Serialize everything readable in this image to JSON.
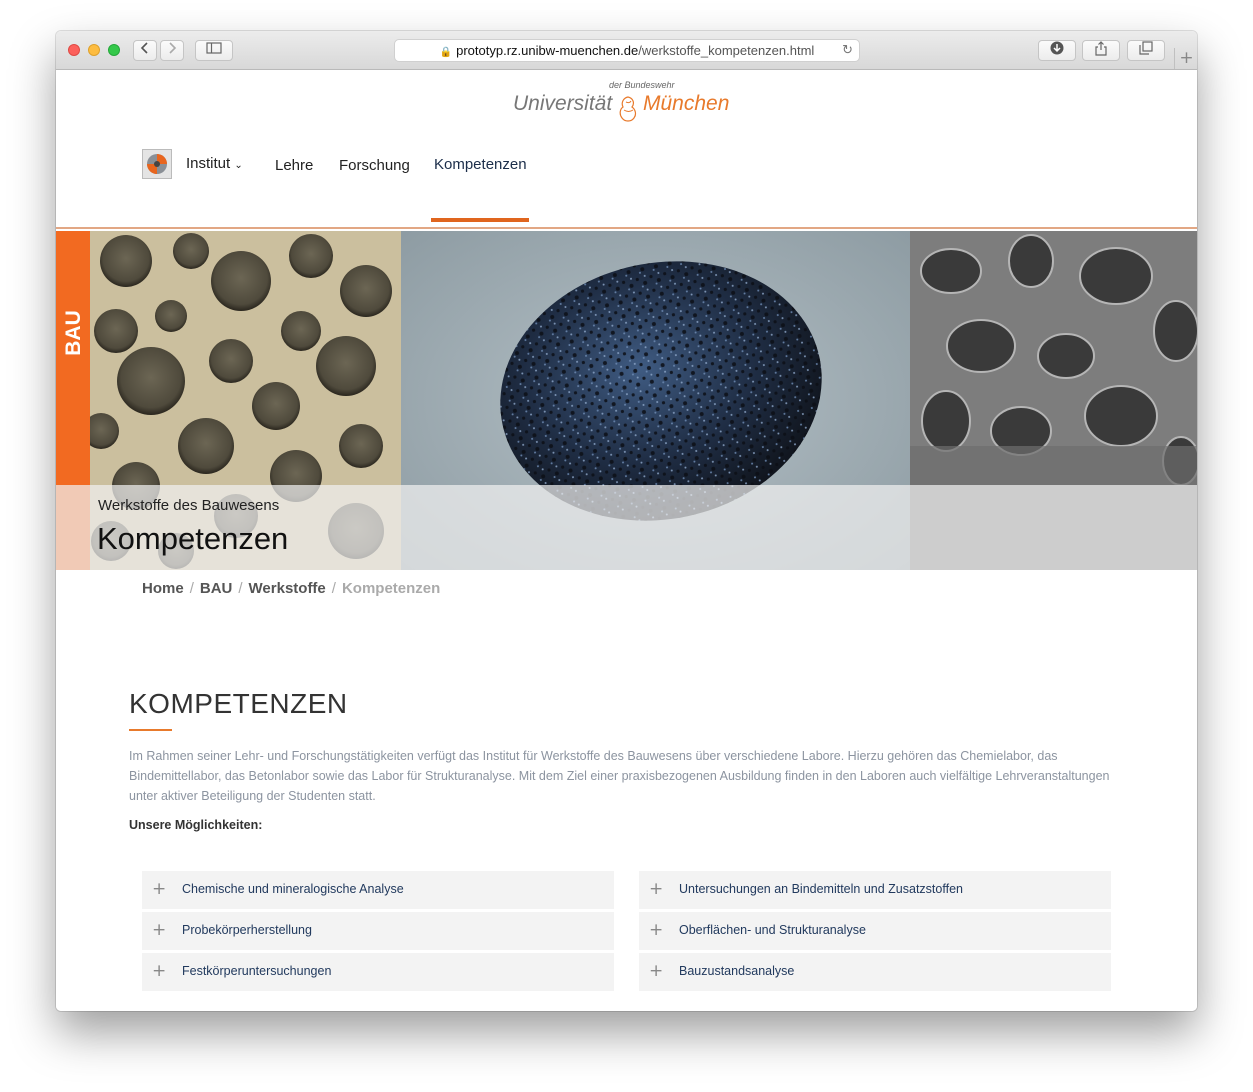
{
  "browser": {
    "url_host": "prototyp.rz.unibw-muenchen.de",
    "url_path": "/werkstoffe_kompetenzen.html"
  },
  "logo": {
    "small": "der Bundeswehr",
    "left": "Universität",
    "right": "München"
  },
  "nav": {
    "items": [
      "Institut",
      "Lehre",
      "Forschung",
      "Kompetenzen"
    ],
    "active": "Kompetenzen"
  },
  "hero": {
    "tab": "BAU",
    "subtitle": "Werkstoffe des Bauwesens",
    "title": "Kompetenzen"
  },
  "breadcrumb": [
    "Home",
    "BAU",
    "Werkstoffe",
    "Kompetenzen"
  ],
  "content": {
    "heading": "KOMPETENZEN",
    "intro": "Im Rahmen seiner Lehr- und Forschungstätigkeiten verfügt das Institut für Werkstoffe des Bauwesens über verschiedene Labore. Hierzu gehören das Chemielabor, das Bindemittellabor, das Betonlabor sowie das Labor für Strukturanalyse. Mit dem Ziel einer praxisbezogenen Ausbildung finden in den Laboren auch vielfältige Lehrveranstaltungen unter aktiver Beteiligung der Studenten statt.",
    "lead": "Unsere Möglichkeiten:",
    "accordion_left": [
      "Chemische und mineralogische Analyse",
      "Probekörperherstellung",
      "Festkörperuntersuchungen"
    ],
    "accordion_right": [
      "Untersuchungen an Bindemitteln und Zusatzstoffen",
      "Oberflächen- und Strukturanalyse",
      "Bauzustandsanalyse"
    ],
    "accordion_icon": "+"
  },
  "colors": {
    "accent": "#e0651e",
    "tab": "#f26a21",
    "link": "#223a5e"
  }
}
